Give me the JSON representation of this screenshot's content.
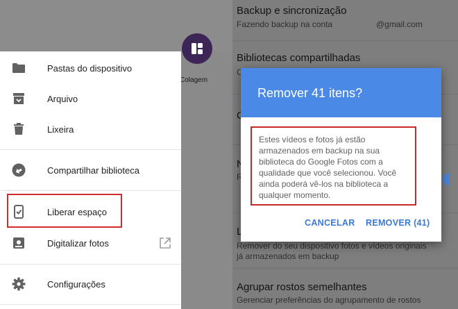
{
  "drawer": {
    "items": [
      {
        "label": "Pastas do dispositivo",
        "icon": "folder-icon"
      },
      {
        "label": "Arquivo",
        "icon": "archive-icon"
      },
      {
        "label": "Lixeira",
        "icon": "trash-icon"
      },
      {
        "label": "Compartilhar biblioteca",
        "icon": "share-library-icon"
      },
      {
        "label": "Liberar espaço",
        "icon": "phone-check-icon"
      },
      {
        "label": "Digitalizar fotos",
        "icon": "scan-photos-icon",
        "trailing_icon": "open-external-icon"
      },
      {
        "label": "Configurações",
        "icon": "gear-icon"
      }
    ]
  },
  "background": {
    "collage_label": "Colagem"
  },
  "settings": {
    "backup_title": "Backup e sincronização",
    "backup_sub_prefix": "Fazendo backup na conta",
    "backup_sub_email": "@gmail.com",
    "shared_title": "Bibliotecas compartilhadas",
    "shared_sub_partial": "C",
    "row3_letter": "C",
    "row4_letter": "N",
    "row4_sub_letter": "R",
    "row5_letter": "L",
    "free_sub_line1": "Remover do seu dispositivo fotos e vídeos originais",
    "free_sub_line2": "já armazenados em backup",
    "faces_title": "Agrupar rostos semelhantes",
    "faces_sub": "Gerenciar preferências do agrupamento de rostos"
  },
  "dialog": {
    "title": "Remover 41 itens?",
    "message": "Estes vídeos e fotos já estão armazenados em backup na sua biblioteca do Google Fotos com a qualidade que você selecionou. Você ainda poderá vê-los na biblioteca a qualquer momento.",
    "cancel_label": "CANCELAR",
    "remove_label": "REMOVER (41)"
  },
  "colors": {
    "dialog_header": "#4a8ae6",
    "button_text": "#3b78d8",
    "highlight_border": "#d42a2a",
    "collage_button": "#3d2558"
  }
}
